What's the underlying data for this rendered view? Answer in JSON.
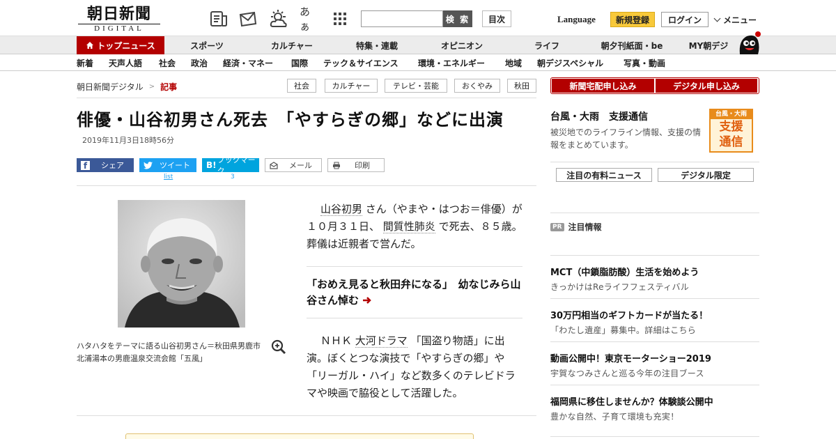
{
  "header": {
    "logo_jp": "朝日新聞",
    "logo_en": "DIGITAL",
    "icons": [
      "newspaper-icon",
      "mail-icon",
      "weather-icon",
      "font-size-icon",
      "grid-icon"
    ],
    "font_icon_text": "あぁ",
    "search_placeholder": "",
    "search_button": "検 索",
    "toc_button": "目次",
    "language": "Language",
    "signup": "新規登録",
    "login": "ログイン",
    "menu": "メニュー"
  },
  "nav1": {
    "top_news": "トップニュース",
    "items": [
      "スポーツ",
      "カルチャー",
      "特集・連載",
      "オピニオン",
      "ライフ",
      "朝夕刊紙面・be",
      "MY朝デジ"
    ]
  },
  "nav2": {
    "items": [
      "新着",
      "天声人語",
      "社会",
      "政治",
      "経済・マネー",
      "国際",
      "テック＆サイエンス",
      "環境・エネルギー",
      "地域",
      "朝デジスペシャル",
      "写真・動画"
    ]
  },
  "breadcrumb": {
    "home": "朝日新聞デジタル",
    "sep": ">",
    "current": "記事"
  },
  "tags": [
    "社会",
    "カルチャー",
    "テレビ・芸能",
    "おくやみ",
    "秋田"
  ],
  "article": {
    "title": "俳優・山谷初男さん死去　「やすらぎの郷」などに出演",
    "date": "2019年11月3日18時56分",
    "share": {
      "facebook": "シェア",
      "twitter": "ツイート",
      "twitter_count": "list",
      "hatena": "ブックマーク",
      "hatena_icon": "B!",
      "hatena_count": "3",
      "mail": "メール",
      "print": "印刷"
    },
    "caption": "ハタハタをテーマに語る山谷初男さん＝秋田県男鹿市北浦湯本の男鹿温泉交流会館「五風」",
    "p1_link1": "山谷初男",
    "p1_a": "さん（やまや・はつお＝俳優）が１０月３１日、",
    "p1_link2": "間質性肺炎",
    "p1_b": "で死去、８５歳。葬儀は近親者で営んだ。",
    "related": "「おめえ見ると秋田弁になる」　幼なじみら山谷さん悼む",
    "p2_a": "ＮＨＫ",
    "p2_link": "大河ドラマ",
    "p2_b": "「国盗り物語」に出演。ぼくとつな演技で「やすらぎの郷」や「リーガル・ハイ」など数多くのテレビドラマや映画で脇役として活躍した。"
  },
  "sidebar": {
    "sub_home": "新聞宅配申し込み",
    "sub_digital": "デジタル申し込み",
    "typhoon_title": "台風・大雨　支援通信",
    "typhoon_desc": "被災地でのライフライン情報、支援の情報をまとめています。",
    "banner_top": "台風・大雨",
    "banner_l1": "支援",
    "banner_l2": "通信",
    "btn_paid": "注目の有料ニュース",
    "btn_digital": "デジタル限定",
    "pr_badge": "PR",
    "pr_title": "注目情報",
    "ads": [
      {
        "title": "MCT（中鎖脂肪酸）生活を始めよう",
        "sub": "きっかけはReライフフェスティバル"
      },
      {
        "title": "30万円相当のギフトカードが当たる！",
        "sub": "「わたし遺産」募集中。詳細はこちら"
      },
      {
        "title": "動画公開中！東京モーターショー2019",
        "sub": "宇賀なつみさんと巡る今年の注目ブース"
      },
      {
        "title": "福岡県に移住しませんか？体験談公開中",
        "sub": "豊かな自然、子育て環境も充実！"
      }
    ]
  },
  "colors": {
    "brand_red": "#b30000",
    "signup_yellow": "#f8c93a",
    "facebook": "#3b5998",
    "twitter": "#1da1f2",
    "hatena": "#00a4de"
  }
}
